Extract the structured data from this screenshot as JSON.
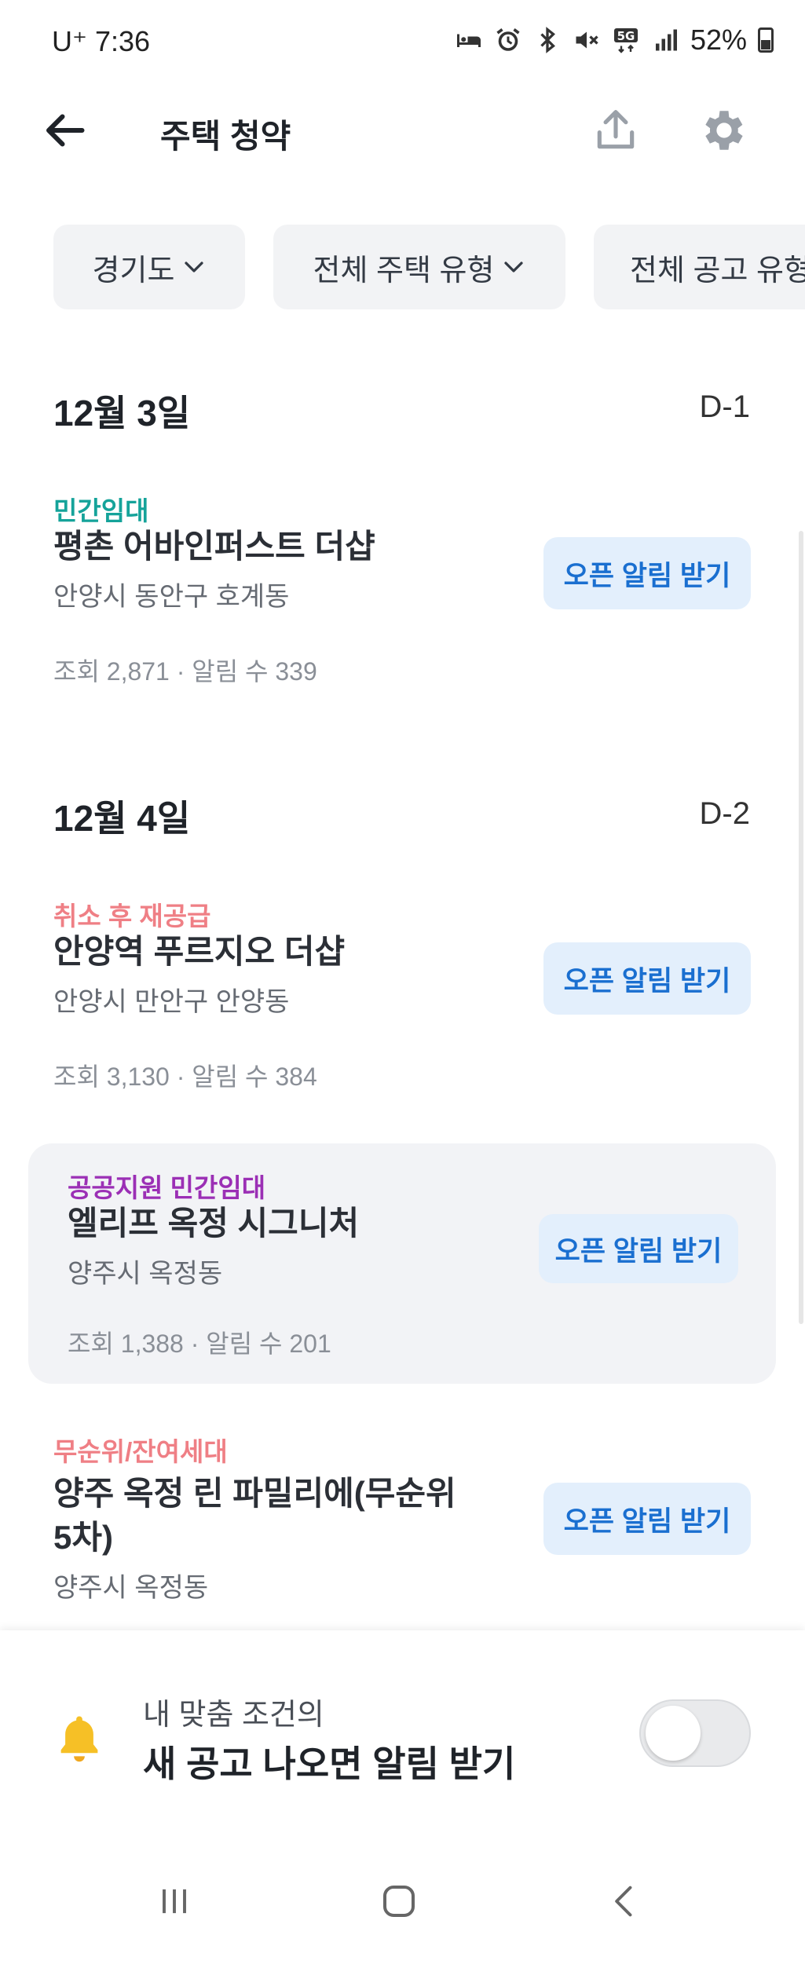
{
  "status_bar": {
    "carrier_time": "U⁺ 7:36",
    "battery": "52%",
    "icons": [
      "bed-icon",
      "alarm-icon",
      "bluetooth-icon",
      "mute-icon",
      "5g-icon",
      "signal-icon",
      "battery-icon"
    ]
  },
  "header": {
    "title": "주택 청약",
    "icons": [
      "back-arrow-icon",
      "share-icon",
      "gear-icon"
    ]
  },
  "filters": [
    {
      "label": "경기도"
    },
    {
      "label": "전체 주택 유형"
    },
    {
      "label": "전체 공고 유형"
    }
  ],
  "sections": [
    {
      "date": "12월 3일",
      "dday": "D-1",
      "items": [
        {
          "tag": "민간임대",
          "tag_color": "#15a39a",
          "title": "평촌 어바인퍼스트 더샵",
          "address": "안양시 동안구 호계동",
          "stats": "조회 2,871 · 알림 수 339",
          "button": "오픈 알림 받기"
        }
      ]
    },
    {
      "date": "12월 4일",
      "dday": "D-2",
      "items": [
        {
          "tag": "취소 후 재공급",
          "tag_color": "#ef7f85",
          "title": "안양역 푸르지오 더샵",
          "address": "안양시 만안구 안양동",
          "stats": "조회 3,130 · 알림 수 384",
          "button": "오픈 알림 받기"
        },
        {
          "tag": "공공지원 민간임대",
          "tag_color": "#9b2fb5",
          "title": "엘리프 옥정 시그니처",
          "address": "양주시 옥정동",
          "stats": "조회 1,388 · 알림 수 201",
          "button": "오픈 알림 받기"
        },
        {
          "tag": "무순위/잔여세대",
          "tag_color": "#ef7f85",
          "title_line1": "양주 옥정 린 파밀리에(무순위",
          "title_line2": "5차)",
          "address": "양주시 옥정동",
          "button": "오픈 알림 받기"
        }
      ]
    }
  ],
  "alert_panel": {
    "subtitle": "내 맞춤 조건의",
    "title": "새 공고 나오면 알림 받기",
    "toggle_on": false
  },
  "nav": [
    "recent-apps-icon",
    "home-icon",
    "back-icon"
  ]
}
